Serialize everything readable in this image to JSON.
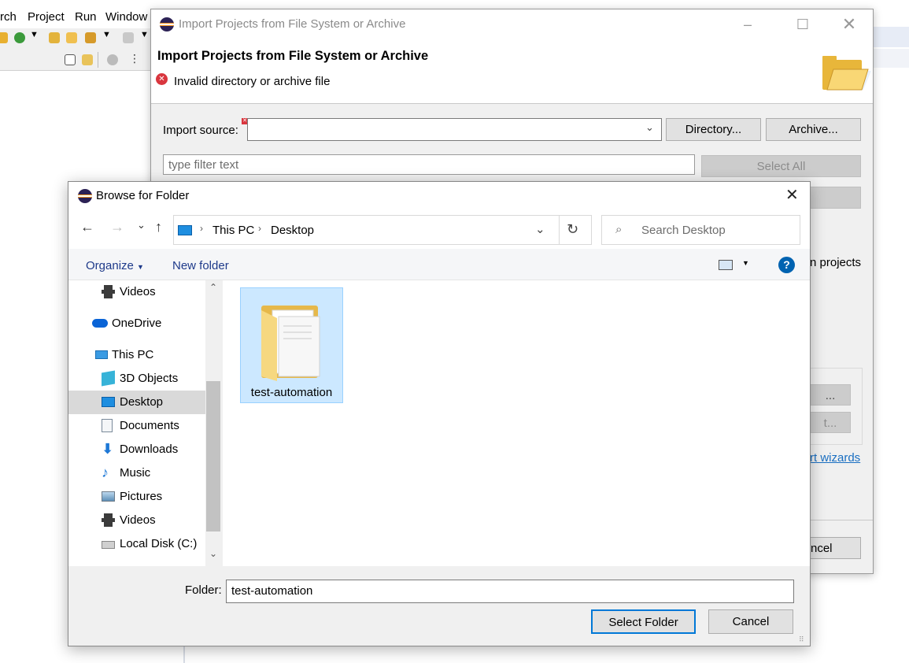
{
  "eclipse": {
    "menu": [
      "rch",
      "Project",
      "Run",
      "Window"
    ]
  },
  "import_dialog": {
    "title": "Import Projects from File System or Archive",
    "header_title": "Import Projects from File System or Archive",
    "error_message": "Invalid directory or archive file",
    "import_source_label": "Import source:",
    "import_source_value": "",
    "directory_button": "Directory...",
    "archive_button": "Archive...",
    "filter_placeholder": "type filter text",
    "select_all_button": "Select All",
    "partial_projects": "n projects",
    "partial_btn1": "...",
    "partial_btn2": "t...",
    "partial_link": "rt wizards",
    "partial_cancel": "ncel"
  },
  "browse_dialog": {
    "title": "Browse for Folder",
    "breadcrumb": [
      "This PC",
      "Desktop"
    ],
    "search_placeholder": "Search Desktop",
    "organize": "Organize",
    "new_folder": "New folder",
    "tree": [
      {
        "label": "Videos",
        "icon": "videos-icon"
      },
      {
        "label": "OneDrive",
        "icon": "onedrive-icon"
      },
      {
        "label": "This PC",
        "icon": "this-pc-icon"
      },
      {
        "label": "3D Objects",
        "icon": "3d-objects-icon"
      },
      {
        "label": "Desktop",
        "icon": "desktop-icon",
        "selected": true
      },
      {
        "label": "Documents",
        "icon": "documents-icon"
      },
      {
        "label": "Downloads",
        "icon": "downloads-icon"
      },
      {
        "label": "Music",
        "icon": "music-icon"
      },
      {
        "label": "Pictures",
        "icon": "pictures-icon"
      },
      {
        "label": "Videos",
        "icon": "videos-icon"
      },
      {
        "label": "Local Disk (C:)",
        "icon": "local-disk-icon"
      }
    ],
    "items": [
      {
        "label": "test-automation",
        "icon": "folder-icon",
        "selected": true
      }
    ],
    "folder_label": "Folder:",
    "folder_value": "test-automation",
    "select_folder_button": "Select Folder",
    "cancel_button": "Cancel"
  },
  "colors": {
    "selection": "#cce8ff",
    "tree_selection": "#d9d9d9",
    "accent": "#0078d7",
    "error": "#d9363e"
  }
}
